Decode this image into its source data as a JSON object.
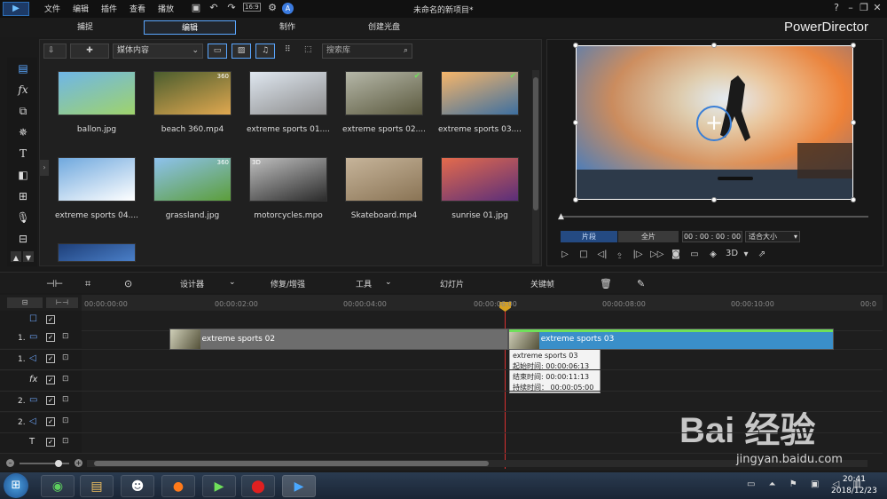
{
  "window": {
    "title": "未命名的新项目*",
    "app_name": "PowerDirector",
    "menu": [
      "文件",
      "编辑",
      "插件",
      "查看",
      "播放"
    ],
    "quick_icons": [
      "save-icon",
      "undo-icon",
      "redo-icon",
      "aspect-ratio-icon",
      "settings-icon",
      "account-icon"
    ],
    "aspect_ratio": "16:9",
    "window_buttons": [
      "help-icon",
      "minimize-icon",
      "restore-icon",
      "close-icon"
    ]
  },
  "modes": {
    "items": [
      "捕捉",
      "编辑",
      "制作",
      "创建光盘"
    ],
    "active_index": 1
  },
  "sidebar": {
    "items": [
      "media-room-icon",
      "fx-icon",
      "pip-icon",
      "particle-icon",
      "title-icon",
      "transition-icon",
      "audio-mixing-icon",
      "voiceover-icon",
      "chapter-icon",
      "subtitle-icon"
    ]
  },
  "library": {
    "toolbar": {
      "import_icon": "import-icon",
      "plugin_icon": "plugin-icon",
      "dropdown_value": "媒体内容",
      "filters": [
        "video-filter",
        "image-filter",
        "audio-filter"
      ],
      "view_icons": [
        "grid-view-icon",
        "expand-icon"
      ],
      "search_placeholder": "搜索库"
    },
    "items": [
      {
        "name": "ballon.jpg",
        "badge": "",
        "checked": false,
        "colors": [
          "#6fb6e8",
          "#9fd36b"
        ]
      },
      {
        "name": "beach 360.mp4",
        "badge": "360",
        "checked": false,
        "colors": [
          "#4b5d2e",
          "#e0a850"
        ]
      },
      {
        "name": "extreme sports 01....",
        "badge": "",
        "checked": false,
        "colors": [
          "#dfe7f0",
          "#8c8c8c"
        ]
      },
      {
        "name": "extreme sports 02....",
        "badge": "",
        "checked": true,
        "colors": [
          "#b5b7a8",
          "#5c5a3f"
        ]
      },
      {
        "name": "extreme sports 03....",
        "badge": "",
        "checked": true,
        "colors": [
          "#f7b66a",
          "#3d6fa0"
        ]
      },
      {
        "name": "extreme sports 04....",
        "badge": "",
        "checked": false,
        "colors": [
          "#6fa8de",
          "#ffffff"
        ]
      },
      {
        "name": "grassland.jpg",
        "badge": "360",
        "checked": false,
        "colors": [
          "#8ec2ee",
          "#5c9e3a"
        ]
      },
      {
        "name": "motorcycles.mpo",
        "badge": "3D",
        "checked": false,
        "colors": [
          "#bfbfbf",
          "#2b2b2b"
        ]
      },
      {
        "name": "Skateboard.mp4",
        "badge": "",
        "checked": false,
        "colors": [
          "#c6b49a",
          "#8a7455"
        ]
      },
      {
        "name": "sunrise 01.jpg",
        "badge": "",
        "checked": false,
        "colors": [
          "#e46b4c",
          "#5a2e7a"
        ]
      },
      {
        "name": "",
        "badge": "",
        "checked": false,
        "colors": [
          "#1e3f79",
          "#4a7fc8"
        ]
      }
    ]
  },
  "preview": {
    "tab_clip": "片段",
    "tab_full": "全片",
    "timecode": "00 : 00 : 00 : 00",
    "fit": "适合大小",
    "stereo": "3D",
    "controls": [
      "play-icon",
      "stop-icon",
      "prev-frame-icon",
      "split-icon",
      "next-frame-icon",
      "fast-forward-icon",
      "snapshot-icon",
      "subtitle-icon",
      "volume-icon",
      "3d-icon",
      "undock-icon"
    ]
  },
  "edit_toolbar": {
    "items": [
      "设计器",
      "修复/增强",
      "工具",
      "幻灯片",
      "关键帧"
    ],
    "icons": [
      "split-track-icon",
      "crop-icon",
      "chevron-icon",
      "trash-icon",
      "edit-icon"
    ]
  },
  "timeline": {
    "ticks": [
      "00:00:00:00",
      "00:00:02:00",
      "00:00:04:00",
      "00:00:06:00",
      "00:00:08:00",
      "00:00:10:00",
      "00:0"
    ],
    "tracks": [
      {
        "label": "",
        "type": "all-tracks-icon"
      },
      {
        "label": "1.",
        "type": "video-track-icon"
      },
      {
        "label": "1.",
        "type": "audio-track-icon"
      },
      {
        "label": "",
        "type": "fx-track-icon"
      },
      {
        "label": "2.",
        "type": "video-track-icon"
      },
      {
        "label": "2.",
        "type": "audio-track-icon"
      },
      {
        "label": "",
        "type": "title-track-icon"
      }
    ],
    "clips": [
      {
        "name": "extreme sports 02",
        "start": 1.3,
        "end": 6.5
      },
      {
        "name": "extreme sports 03",
        "start": 6.5,
        "end": 11.5
      }
    ],
    "playhead_seconds": 6.5,
    "tooltip": {
      "title": "extreme sports 03",
      "start": "起始时间: 00:00:06:13",
      "end": "结束时间: 00:00:11:13",
      "duration": "持续时间： 00:00:05:00"
    }
  },
  "taskbar": {
    "apps": [
      "windows-start-icon",
      "browser-icon",
      "file-explorer-icon",
      "qq-icon",
      "firefox-icon",
      "media-player-icon",
      "record-icon",
      "powerdirector-icon"
    ],
    "time": "20:41",
    "date": "2018/12/23"
  },
  "watermark": {
    "text": "Bai 经验",
    "url": "jingyan.baidu.com"
  }
}
